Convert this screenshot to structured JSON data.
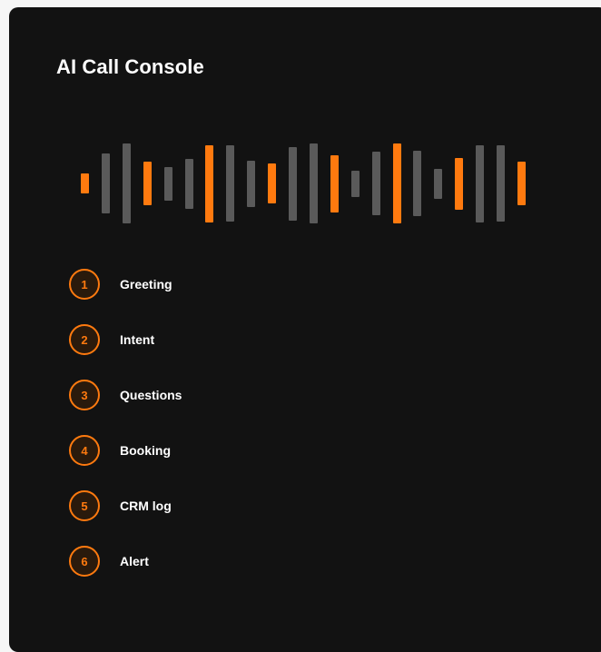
{
  "console": {
    "title": "AI Call Console"
  },
  "waveform": {
    "active_color": "#ff7a0f",
    "inactive_color": "#5a5a5a",
    "bars": [
      {
        "level": 0.25,
        "active": true
      },
      {
        "level": 0.75,
        "active": false
      },
      {
        "level": 1.0,
        "active": false
      },
      {
        "level": 0.55,
        "active": true
      },
      {
        "level": 0.42,
        "active": false
      },
      {
        "level": 0.62,
        "active": false
      },
      {
        "level": 0.97,
        "active": true
      },
      {
        "level": 0.95,
        "active": false
      },
      {
        "level": 0.58,
        "active": false
      },
      {
        "level": 0.5,
        "active": true
      },
      {
        "level": 0.92,
        "active": false
      },
      {
        "level": 1.0,
        "active": false
      },
      {
        "level": 0.72,
        "active": true
      },
      {
        "level": 0.33,
        "active": false
      },
      {
        "level": 0.8,
        "active": false
      },
      {
        "level": 1.0,
        "active": true
      },
      {
        "level": 0.82,
        "active": false
      },
      {
        "level": 0.38,
        "active": false
      },
      {
        "level": 0.65,
        "active": true
      },
      {
        "level": 0.97,
        "active": false
      },
      {
        "level": 0.95,
        "active": false
      },
      {
        "level": 0.55,
        "active": true
      }
    ]
  },
  "steps": [
    {
      "number": "1",
      "label": "Greeting"
    },
    {
      "number": "2",
      "label": "Intent"
    },
    {
      "number": "3",
      "label": "Questions"
    },
    {
      "number": "4",
      "label": "Booking"
    },
    {
      "number": "5",
      "label": "CRM log"
    },
    {
      "number": "6",
      "label": "Alert"
    }
  ]
}
